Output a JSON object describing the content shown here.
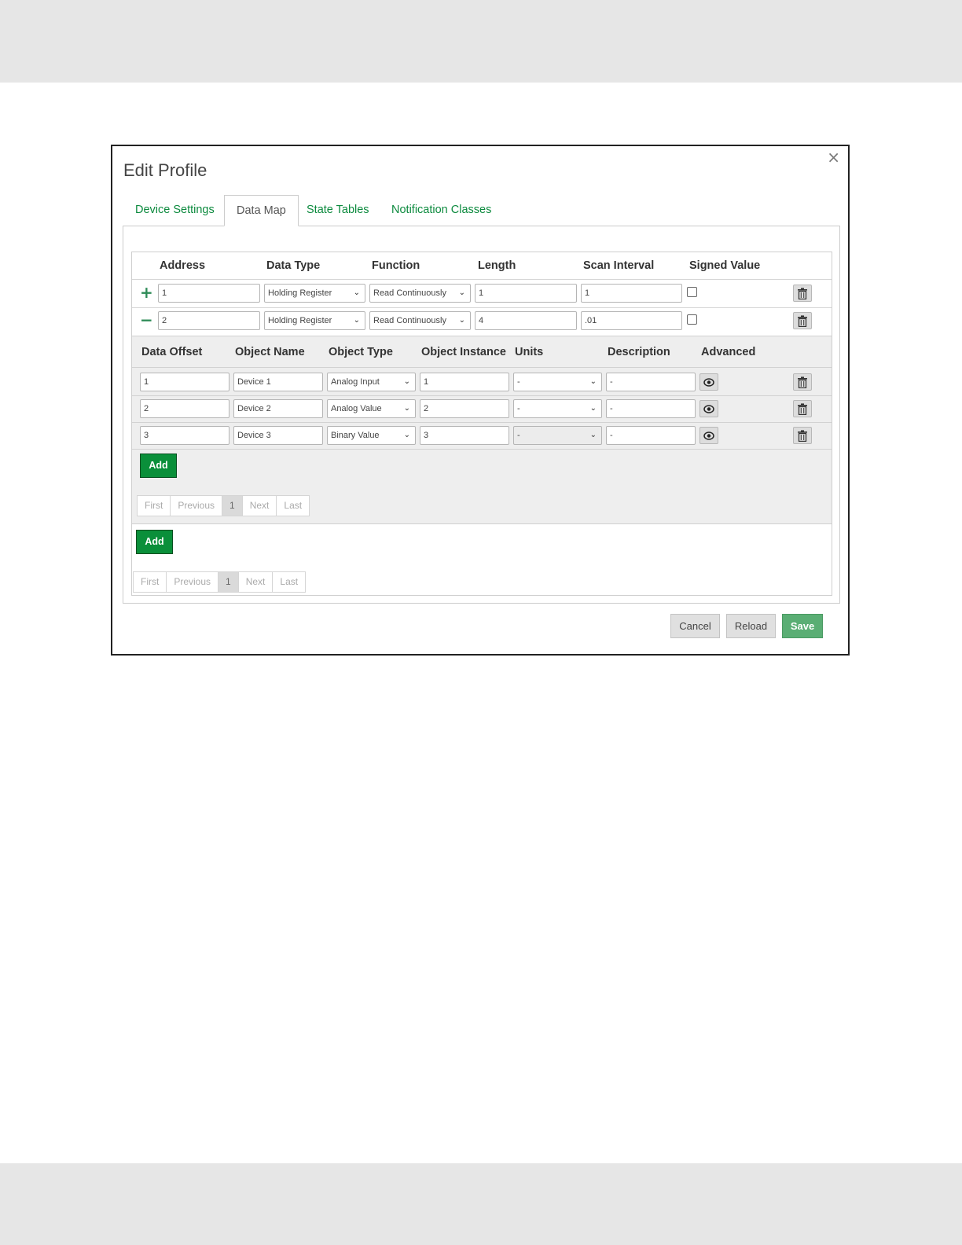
{
  "dialog": {
    "title": "Edit Profile",
    "close_label": "×"
  },
  "tabs": [
    {
      "label": "Device Settings",
      "active": false
    },
    {
      "label": "Data Map",
      "active": true
    },
    {
      "label": "State Tables",
      "active": false
    },
    {
      "label": "Notification Classes",
      "active": false
    }
  ],
  "map_table": {
    "headers": [
      "Address",
      "Data Type",
      "Function",
      "Length",
      "Scan Interval",
      "Signed Value"
    ],
    "rows": [
      {
        "toggle": "expand",
        "address": "1",
        "data_type": "Holding Register",
        "function": "Read Continuously",
        "length": "1",
        "scan_interval": "1",
        "signed": false
      },
      {
        "toggle": "collapse",
        "address": "2",
        "data_type": "Holding Register",
        "function": "Read Continuously",
        "length": "4",
        "scan_interval": ".01",
        "signed": false
      }
    ]
  },
  "object_table": {
    "headers": [
      "Data Offset",
      "Object Name",
      "Object Type",
      "Object Instance",
      "Units",
      "Description",
      "Advanced"
    ],
    "rows": [
      {
        "offset": "1",
        "name": "Device 1",
        "type": "Analog Input",
        "instance": "1",
        "units": "-",
        "units_disabled": false,
        "description": "-"
      },
      {
        "offset": "2",
        "name": "Device 2",
        "type": "Analog Value",
        "instance": "2",
        "units": "-",
        "units_disabled": false,
        "description": "-"
      },
      {
        "offset": "3",
        "name": "Device 3",
        "type": "Binary Value",
        "instance": "3",
        "units": "-",
        "units_disabled": true,
        "description": "-"
      }
    ],
    "add_label": "Add"
  },
  "pager_inner": {
    "first": "First",
    "previous": "Previous",
    "current": "1",
    "next": "Next",
    "last": "Last"
  },
  "outer_add_label": "Add",
  "pager_outer": {
    "first": "First",
    "previous": "Previous",
    "current": "1",
    "next": "Next",
    "last": "Last"
  },
  "footer": {
    "cancel": "Cancel",
    "reload": "Reload",
    "save": "Save"
  },
  "colors": {
    "accent_green": "#0a8f3a",
    "tab_link": "#0c8a3e",
    "save_green": "#5aae74"
  }
}
